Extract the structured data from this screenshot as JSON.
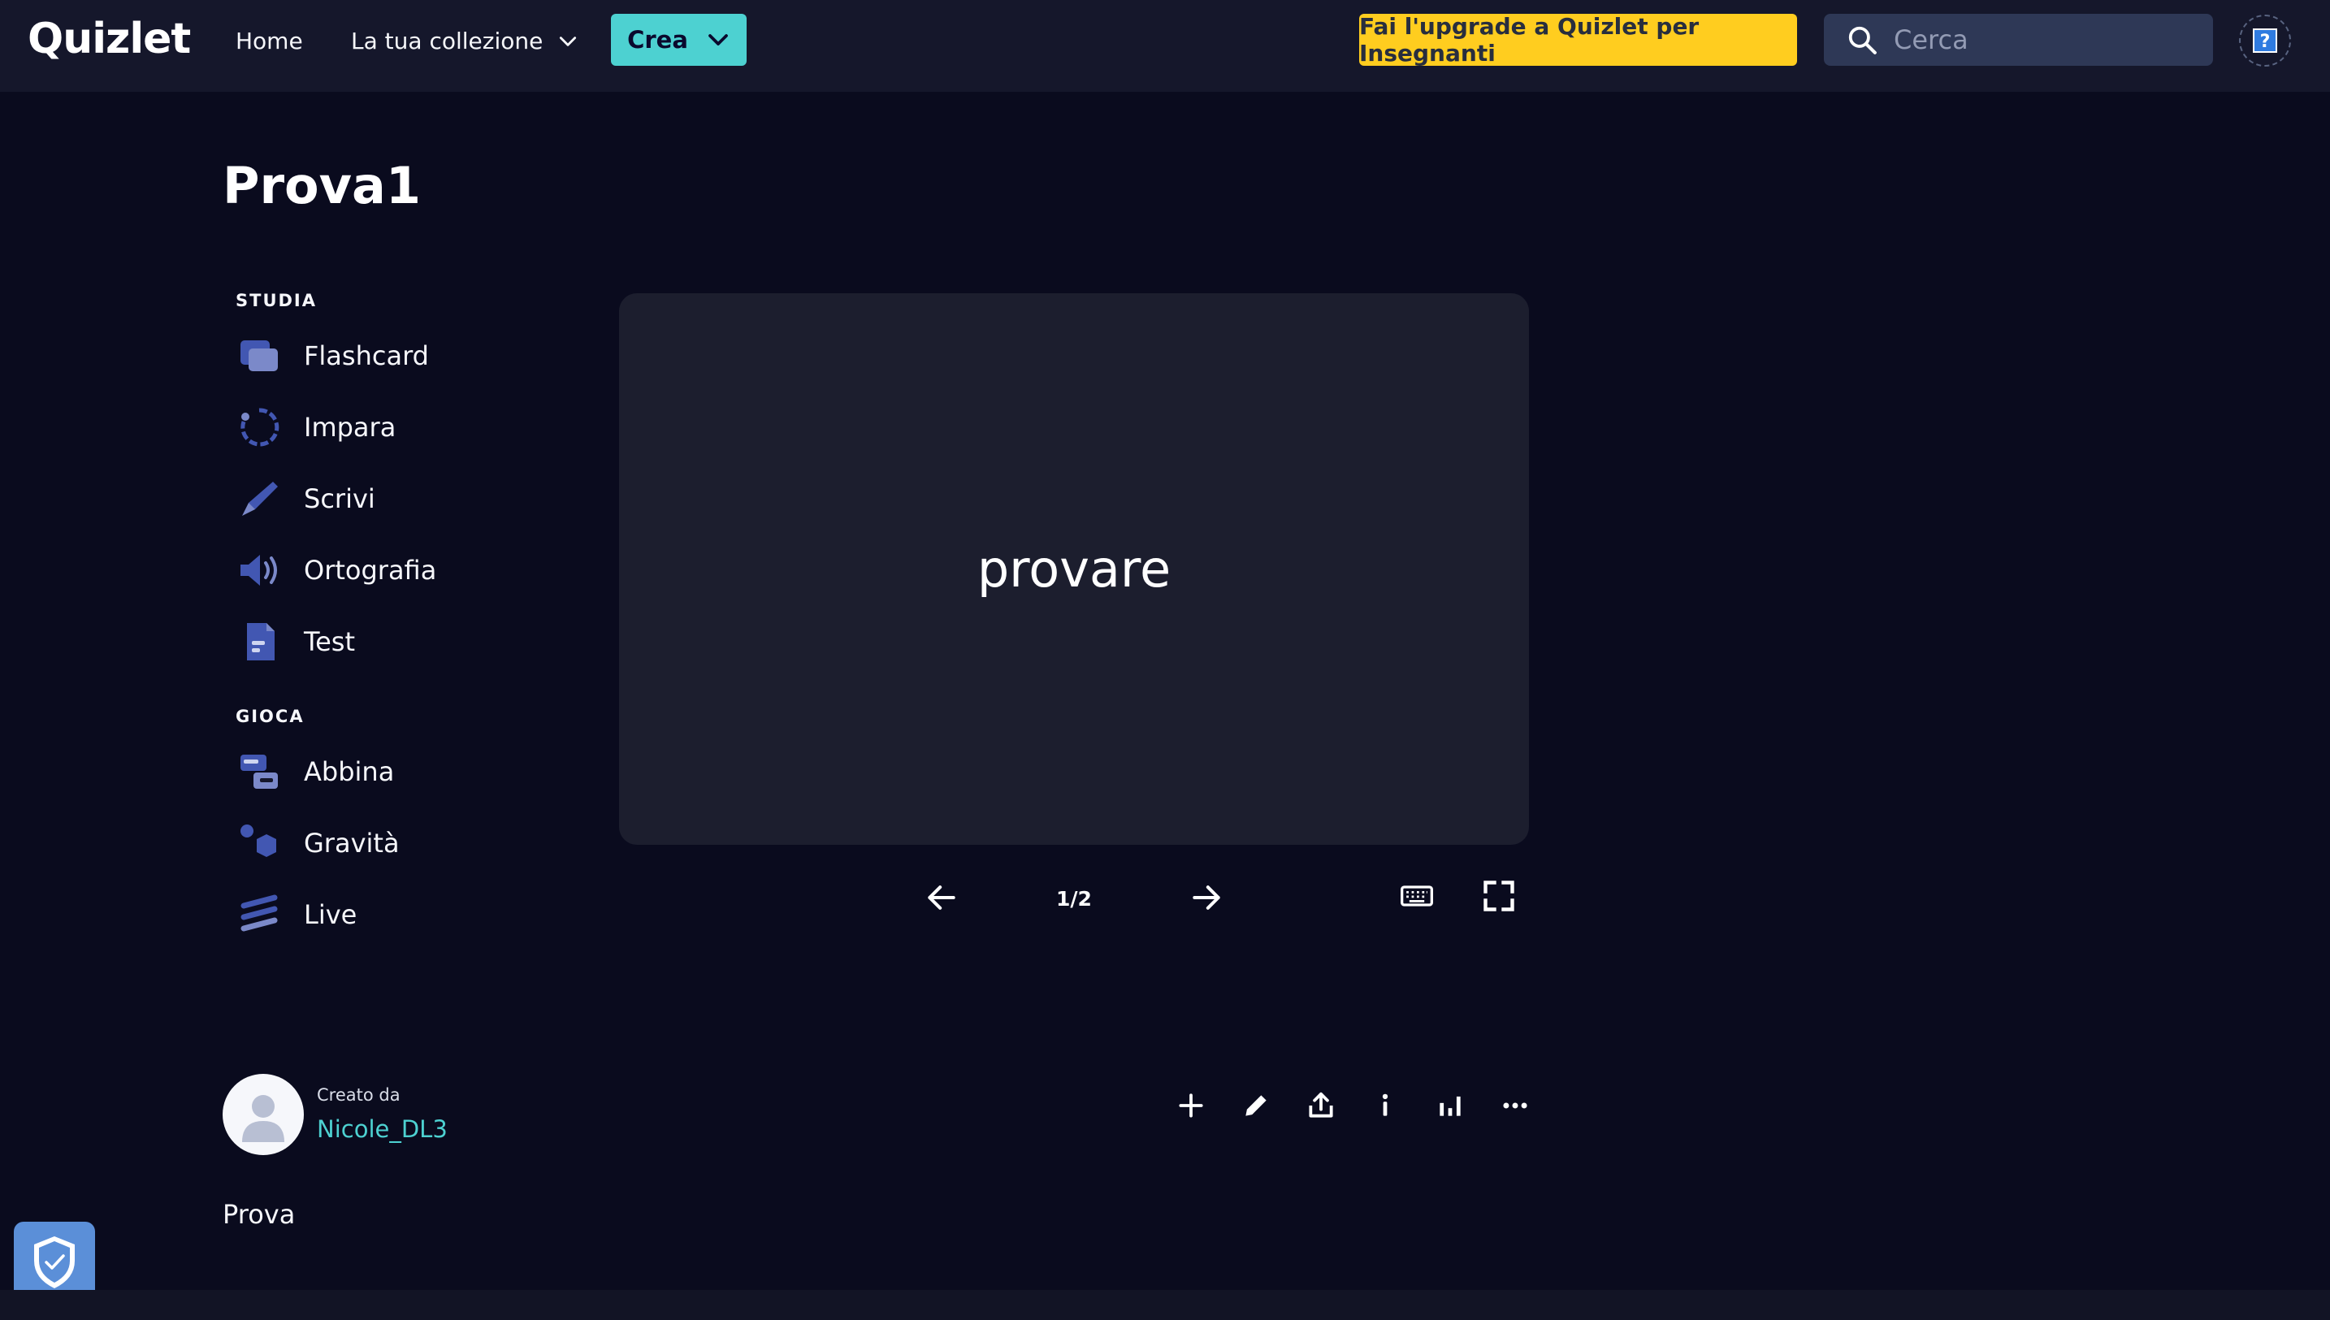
{
  "header": {
    "logo": "Quizlet",
    "nav_home": "Home",
    "nav_collection": "La tua collezione",
    "create_label": "Crea",
    "upgrade_label": "Fai l'upgrade a Quizlet per Insegnanti",
    "search_placeholder": "Cerca",
    "help_icon": "help-icon"
  },
  "set": {
    "title": "Prova1",
    "description": "Prova"
  },
  "sidebar": {
    "study_label": "STUDIA",
    "study_modes": [
      {
        "label": "Flashcard",
        "icon": "flashcards-icon"
      },
      {
        "label": "Impara",
        "icon": "learn-icon"
      },
      {
        "label": "Scrivi",
        "icon": "write-icon"
      },
      {
        "label": "Ortografia",
        "icon": "spell-icon"
      },
      {
        "label": "Test",
        "icon": "test-icon"
      }
    ],
    "play_label": "GIOCA",
    "play_modes": [
      {
        "label": "Abbina",
        "icon": "match-icon"
      },
      {
        "label": "Gravità",
        "icon": "gravity-icon"
      },
      {
        "label": "Live",
        "icon": "live-icon"
      }
    ]
  },
  "flashcard": {
    "term": "provare",
    "counter": "1/2"
  },
  "creator": {
    "label": "Creato da",
    "username": "Nicole_DL3"
  },
  "colors": {
    "background": "#0a0b1e",
    "header": "#15172b",
    "card": "#1c1e2e",
    "accent_teal": "#4dd1d1",
    "upgrade_yellow": "#ffcd1f",
    "mode_icon": "#4257b2"
  }
}
